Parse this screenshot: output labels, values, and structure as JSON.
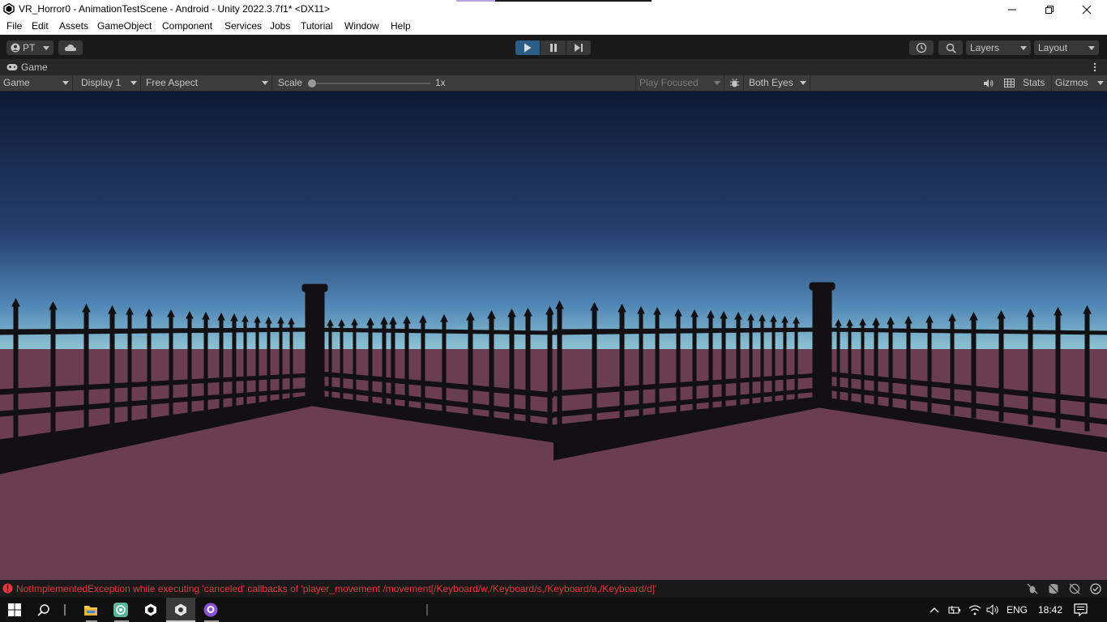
{
  "window": {
    "title": "VR_Horror0 - AnimationTestScene - Android - Unity 2022.3.7f1* <DX11>",
    "minimize_icon": "minimize-icon",
    "maximize_icon": "restore-icon",
    "close_icon": "close-icon"
  },
  "menu": {
    "items": [
      "File",
      "Edit",
      "Assets",
      "GameObject",
      "Component",
      "Services",
      "Jobs",
      "Tutorial",
      "Window",
      "Help"
    ]
  },
  "toolbar": {
    "account_label": "PT",
    "layers_label": "Layers",
    "layout_label": "Layout",
    "play_active_color": "#2c5d87"
  },
  "game_tab": {
    "label": "Game"
  },
  "game_toolbar": {
    "view_mode": "Game",
    "display": "Display 1",
    "aspect": "Free Aspect",
    "scale_label": "Scale",
    "scale_value": "1x",
    "play_mode": "Play Focused",
    "eyes": "Both Eyes",
    "stats_label": "Stats",
    "gizmos_label": "Gizmos"
  },
  "status": {
    "error_message": "NotImplementedException while executing 'canceled' callbacks of 'player_movement /movement[/Keyboard/w,/Keyboard/s,/Keyboard/a,/Keyboard/d]'",
    "error_color": "#e0393e"
  },
  "taskbar": {
    "language": "ENG",
    "time": "18:42"
  },
  "scene_colors": {
    "sky_top": "#0f1a33",
    "sky_mid": "#26406e",
    "horizon": "#8fc4d4",
    "ground": "#6a3d4f",
    "fence": "#121012"
  }
}
